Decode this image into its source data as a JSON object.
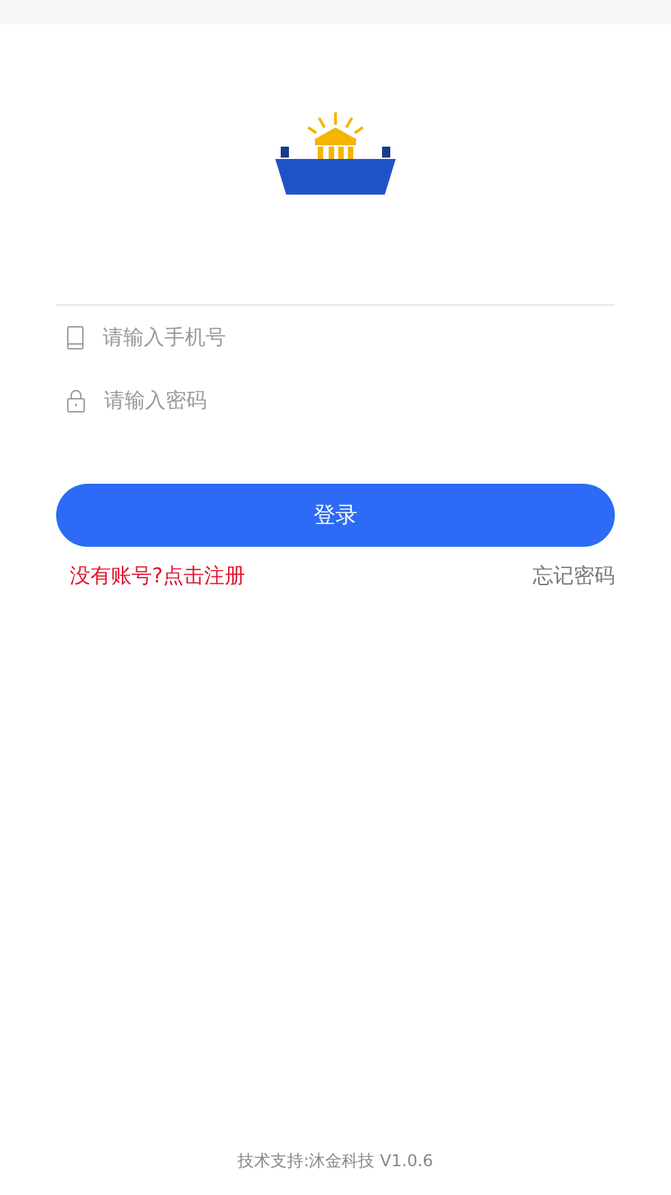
{
  "fields": [
    {
      "kind": "phone",
      "placeholder": "请输入手机号"
    },
    {
      "kind": "password",
      "placeholder": "请输入密码"
    }
  ],
  "login_button": "登录",
  "register_link": "没有账号?点击注册",
  "forgot_link": "忘记密码",
  "footer": "技术支持:沐金科技 V1.0.6"
}
